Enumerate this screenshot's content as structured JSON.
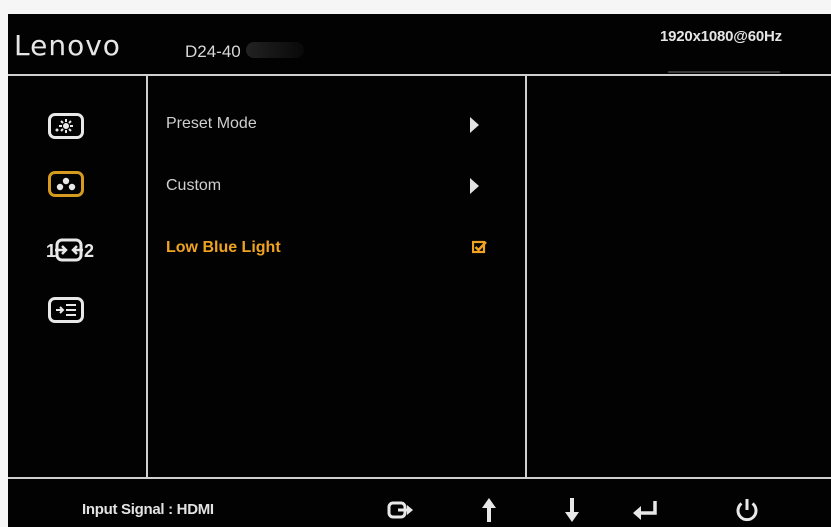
{
  "header": {
    "brand": "Lenovo",
    "model": "D24-40",
    "resolution": "1920x1080@60Hz"
  },
  "sidebar": {
    "icons": [
      {
        "name": "brightness-icon",
        "active": false
      },
      {
        "name": "color-icon",
        "active": true
      },
      {
        "name": "input-switch-icon",
        "active": false
      },
      {
        "name": "menu-settings-icon",
        "active": false
      }
    ]
  },
  "menu": {
    "items": [
      {
        "label": "Preset Mode",
        "indicator": "arrow"
      },
      {
        "label": "Custom",
        "indicator": "arrow"
      },
      {
        "label": "Low Blue Light",
        "indicator": "checkbox",
        "checked": true
      }
    ]
  },
  "footer": {
    "input_signal": "Input Signal : HDMI",
    "keys": [
      "exit-icon",
      "up-arrow-icon",
      "down-arrow-icon",
      "enter-icon",
      "power-icon"
    ]
  },
  "colors": {
    "background": "#020202",
    "accent": "#efa321",
    "text": "#cfcfcf",
    "lines": "#cfcfcf"
  }
}
